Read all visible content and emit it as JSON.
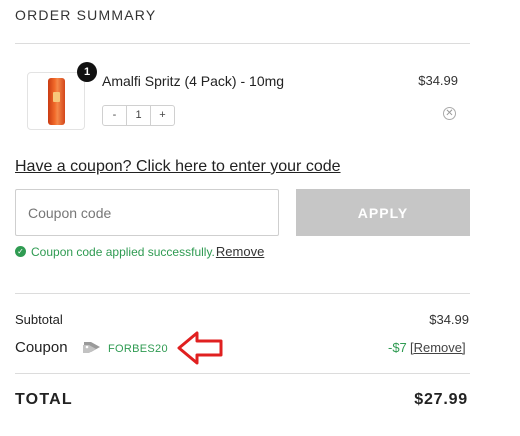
{
  "summary": {
    "title": "ORDER SUMMARY"
  },
  "item": {
    "quantity_badge": "1",
    "name": "Amalfi Spritz (4 Pack) - 10mg",
    "price": "$34.99",
    "stepper": {
      "minus": "-",
      "value": "1",
      "plus": "+"
    },
    "remove_icon": "circle-x-icon"
  },
  "coupon": {
    "link_text": "Have a coupon? Click here to enter your code",
    "input_placeholder": "Coupon code",
    "apply_label": "APPLY",
    "success_text": "Coupon code applied successfully.",
    "success_remove": "Remove"
  },
  "totals": {
    "subtotal_label": "Subtotal",
    "subtotal_value": "$34.99",
    "coupon_label": "Coupon",
    "coupon_code": "FORBES20",
    "coupon_discount": "-$7",
    "coupon_remove": "[Remove]",
    "total_label": "TOTAL",
    "total_value": "$27.99"
  },
  "colors": {
    "success_green": "#2f9b52",
    "annotation_red": "#e02020",
    "apply_disabled": "#c6c6c6"
  }
}
